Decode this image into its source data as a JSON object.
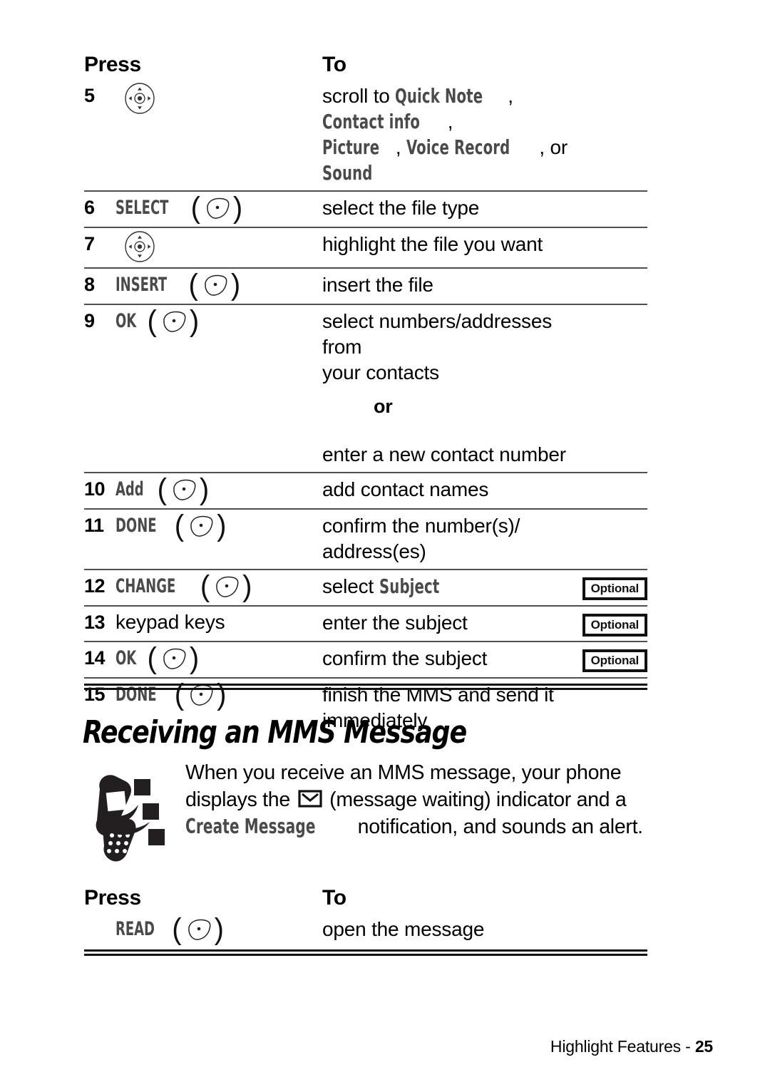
{
  "table_a": {
    "headers": {
      "press": "Press",
      "to": "To"
    },
    "rows": [
      {
        "num": "5",
        "key_type": "nav",
        "key_label": "",
        "to_parts": [
          {
            "t": "scroll to ",
            "style": "plain"
          },
          {
            "t": "Quick Note",
            "style": "display"
          },
          {
            "t": ", ",
            "style": "plain"
          },
          {
            "t": "Contact info",
            "style": "display"
          },
          {
            "t": ",",
            "style": "plain"
          },
          {
            "t": "\n",
            "style": "break"
          },
          {
            "t": "Picture",
            "style": "display"
          },
          {
            "t": ", ",
            "style": "plain"
          },
          {
            "t": "Voice Record",
            "style": "display"
          },
          {
            "t": ", or ",
            "style": "plain"
          },
          {
            "t": "Sound",
            "style": "display"
          }
        ],
        "optional": "",
        "rule_top": false
      },
      {
        "num": "6",
        "key_type": "soft",
        "key_label": "SELECT",
        "to_parts": [
          {
            "t": "select the file type",
            "style": "plain"
          }
        ],
        "optional": "",
        "rule_top": true
      },
      {
        "num": "7",
        "key_type": "nav",
        "key_label": "",
        "to_parts": [
          {
            "t": "highlight the file you want",
            "style": "plain"
          }
        ],
        "optional": "",
        "rule_top": true
      },
      {
        "num": "8",
        "key_type": "soft",
        "key_label": "INSERT",
        "to_parts": [
          {
            "t": "insert the file",
            "style": "plain"
          }
        ],
        "optional": "",
        "rule_top": true
      },
      {
        "num": "9",
        "key_type": "soft",
        "key_label": "OK",
        "to_parts": [
          {
            "t": "select numbers/addresses from",
            "style": "plain"
          },
          {
            "t": "\n",
            "style": "break"
          },
          {
            "t": "your contacts",
            "style": "plain"
          }
        ],
        "optional": "",
        "rule_top": true
      },
      {
        "num": "",
        "key_type": "none",
        "key_label": "",
        "or_word": "or",
        "to_parts": [
          {
            "t": "enter a new contact number",
            "style": "plain"
          }
        ],
        "optional": "",
        "rule_top": false
      },
      {
        "num": "10",
        "key_type": "soft",
        "key_label": "Add",
        "to_parts": [
          {
            "t": "add contact names",
            "style": "plain"
          }
        ],
        "optional": "",
        "rule_top": true
      },
      {
        "num": "11",
        "key_type": "soft",
        "key_label": "DONE",
        "to_parts": [
          {
            "t": "confirm the number(s)/",
            "style": "plain"
          },
          {
            "t": "\n",
            "style": "break"
          },
          {
            "t": "address(es)",
            "style": "plain"
          }
        ],
        "optional": "",
        "rule_top": true
      },
      {
        "num": "12",
        "key_type": "soft",
        "key_label": "CHANGE",
        "to_parts": [
          {
            "t": "select ",
            "style": "plain"
          },
          {
            "t": "Subject",
            "style": "display"
          }
        ],
        "optional": "Optional",
        "rule_top": true
      },
      {
        "num": "13",
        "key_type": "plain",
        "key_label": "keypad keys",
        "to_parts": [
          {
            "t": "enter the subject",
            "style": "plain"
          }
        ],
        "optional": "Optional",
        "rule_top": true
      },
      {
        "num": "14",
        "key_type": "soft",
        "key_label": "OK",
        "to_parts": [
          {
            "t": "confirm the subject",
            "style": "plain"
          }
        ],
        "optional": "Optional",
        "rule_top": true
      },
      {
        "num": "15",
        "key_type": "soft",
        "key_label": "DONE",
        "to_parts": [
          {
            "t": "finish the MMS and send it",
            "style": "plain"
          },
          {
            "t": "\n",
            "style": "break"
          },
          {
            "t": "immediately",
            "style": "plain"
          }
        ],
        "optional": "",
        "rule_top": true
      }
    ]
  },
  "section": {
    "heading": "Receiving an MMS Message",
    "note_parts": [
      {
        "t": "When you receive an MMS message, your phone",
        "style": "plain"
      },
      {
        "t": "\n",
        "style": "break"
      },
      {
        "t": "displays the ",
        "style": "plain"
      },
      {
        "t": "envelope-icon",
        "style": "icon"
      },
      {
        "t": " (message waiting) indicator and a",
        "style": "plain"
      },
      {
        "t": "\n",
        "style": "break"
      },
      {
        "t": "Create Message",
        "style": "display"
      },
      {
        "t": " notification, and sounds an alert.",
        "style": "plain"
      }
    ],
    "note_icon_name": "phone-alert-icon"
  },
  "table_b": {
    "headers": {
      "press": "Press",
      "to": "To"
    },
    "rows": [
      {
        "num": "",
        "key_type": "soft",
        "key_label": "READ",
        "to_parts": [
          {
            "t": "open the message",
            "style": "plain"
          }
        ],
        "optional": "",
        "rule_top": false
      }
    ]
  },
  "footer": {
    "label": "Highlight Features - ",
    "page": "25"
  },
  "colors": {
    "display_text": "#4a4a4a",
    "body_text": "#000000",
    "rule": "#4f4f4f",
    "rule_heavy": "#111111"
  }
}
